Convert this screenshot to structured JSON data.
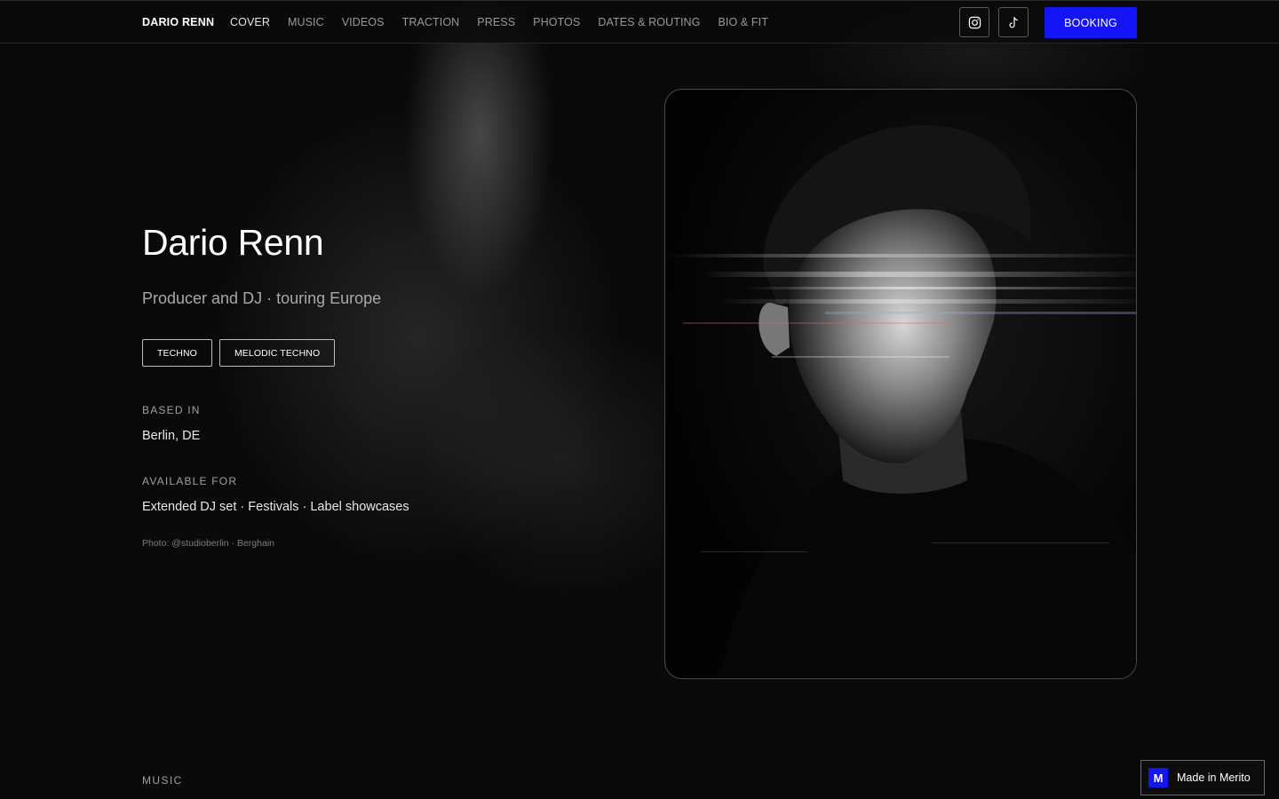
{
  "nav": {
    "brand": "DARIO RENN",
    "links": [
      "COVER",
      "MUSIC",
      "VIDEOS",
      "TRACTION",
      "PRESS",
      "PHOTOS",
      "DATES & ROUTING",
      "BIO & FIT"
    ],
    "active_link": "COVER",
    "social_icons": [
      "instagram-icon",
      "tiktok-icon"
    ],
    "booking_label": "BOOKING",
    "booking_color": "#1414f5"
  },
  "hero": {
    "name": "Dario Renn",
    "tagline": "Producer and DJ · touring Europe",
    "genres": [
      "TECHNO",
      "MELODIC TECHNO"
    ],
    "based_in_label": "BASED IN",
    "based_in": "Berlin, DE",
    "available_label": "AVAILABLE FOR",
    "available_for": "Extended DJ set · Festivals · Label showcases",
    "photo_credit": "Photo: @studioberlin · Berghain"
  },
  "next_section_label": "MUSIC",
  "badge": {
    "logo_letter": "M",
    "text": "Made in Merito"
  }
}
